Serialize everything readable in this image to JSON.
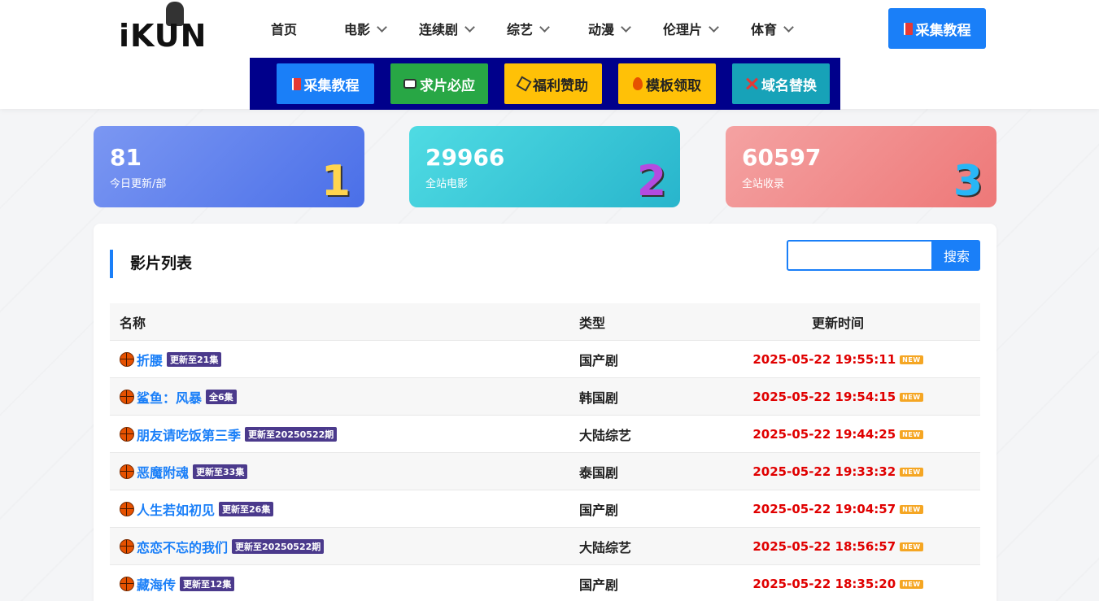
{
  "logo": {
    "text": "iKUN"
  },
  "nav": [
    {
      "label": "首页",
      "dropdown": false
    },
    {
      "label": "电影",
      "dropdown": true
    },
    {
      "label": "连续剧",
      "dropdown": true
    },
    {
      "label": "综艺",
      "dropdown": true
    },
    {
      "label": "动漫",
      "dropdown": true
    },
    {
      "label": "伦理片",
      "dropdown": true
    },
    {
      "label": "体育",
      "dropdown": true
    }
  ],
  "header_button": {
    "label": "采集教程",
    "icon": "book-icon",
    "color": "#1a7ff8"
  },
  "quick_buttons": [
    {
      "label": "采集教程",
      "icon": "book-icon",
      "bg": "#1a7ff8",
      "fg": "#ffffff"
    },
    {
      "label": "求片必应",
      "icon": "chat-icon",
      "bg": "#28a745",
      "fg": "#ffffff"
    },
    {
      "label": "福利赞助",
      "icon": "gift-icon",
      "bg": "#ffc107",
      "fg": "#222222"
    },
    {
      "label": "模板领取",
      "icon": "fire-icon",
      "bg": "#ffc107",
      "fg": "#222222"
    },
    {
      "label": "域名替换",
      "icon": "cross-icon",
      "bg": "#17a2b8",
      "fg": "#ffffff"
    }
  ],
  "stats": [
    {
      "value": "81",
      "label": "今日更新/部",
      "badge": "1",
      "gradient": [
        "#6d8ff0",
        "#4a6fe8"
      ]
    },
    {
      "value": "29966",
      "label": "全站电影",
      "badge": "2",
      "gradient": [
        "#45d6df",
        "#2bb9cf"
      ]
    },
    {
      "value": "60597",
      "label": "全站收录",
      "badge": "3",
      "gradient": [
        "#f19999",
        "#ee7a7a"
      ]
    }
  ],
  "panel": {
    "title": "影片列表",
    "search": {
      "placeholder": "",
      "button": "搜索"
    }
  },
  "table": {
    "headers": {
      "name": "名称",
      "type": "类型",
      "time": "更新时间"
    },
    "rows": [
      {
        "title": "折腰",
        "episode": "更新至21集",
        "type": "国产剧",
        "time": "2025-05-22 19:55:11",
        "new": "NEW"
      },
      {
        "title": "鲨鱼：风暴",
        "episode": "全6集",
        "type": "韩国剧",
        "time": "2025-05-22 19:54:15",
        "new": "NEW"
      },
      {
        "title": "朋友请吃饭第三季",
        "episode": "更新至20250522期",
        "type": "大陆综艺",
        "time": "2025-05-22 19:44:25",
        "new": "NEW"
      },
      {
        "title": "恶魔附魂",
        "episode": "更新至33集",
        "type": "泰国剧",
        "time": "2025-05-22 19:33:32",
        "new": "NEW"
      },
      {
        "title": "人生若如初见",
        "episode": "更新至26集",
        "type": "国产剧",
        "time": "2025-05-22 19:04:57",
        "new": "NEW"
      },
      {
        "title": "恋恋不忘的我们",
        "episode": "更新至20250522期",
        "type": "大陆综艺",
        "time": "2025-05-22 18:56:57",
        "new": "NEW"
      },
      {
        "title": "藏海传",
        "episode": "更新至12集",
        "type": "国产剧",
        "time": "2025-05-22 18:35:20",
        "new": "NEW"
      }
    ]
  }
}
